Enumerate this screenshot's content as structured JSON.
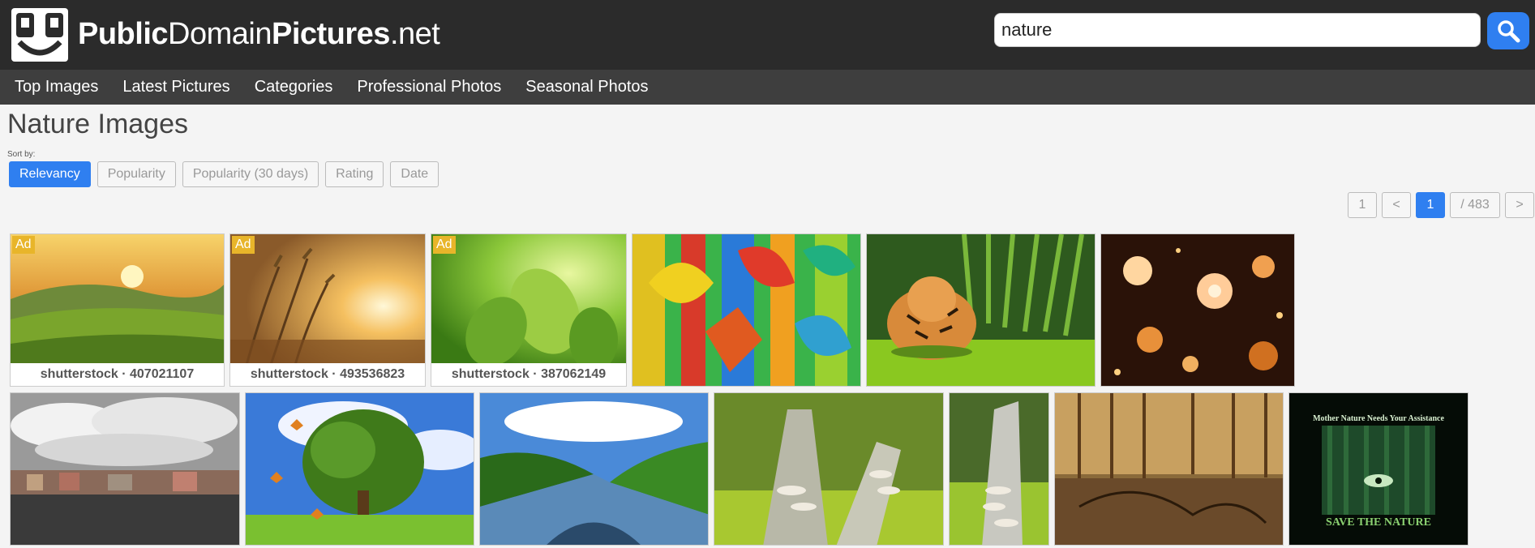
{
  "site": {
    "logo_bold_1": "Public",
    "logo_light": "Domain",
    "logo_bold_2": "Pictures",
    "logo_tld": ".net"
  },
  "search": {
    "value": "nature",
    "icon": "search-icon"
  },
  "nav": {
    "items": [
      {
        "label": "Top Images"
      },
      {
        "label": "Latest Pictures"
      },
      {
        "label": "Categories"
      },
      {
        "label": "Professional Photos"
      },
      {
        "label": "Seasonal Photos"
      }
    ]
  },
  "page": {
    "title": "Nature Images",
    "sort_label": "Sort by:"
  },
  "sort": {
    "options": [
      {
        "label": "Relevancy",
        "active": true
      },
      {
        "label": "Popularity"
      },
      {
        "label": "Popularity (30 days)"
      },
      {
        "label": "Rating"
      },
      {
        "label": "Date"
      }
    ]
  },
  "pagination": {
    "first": "1",
    "prev": "<",
    "current": "1",
    "total": "/ 483",
    "next": ">"
  },
  "ads": [
    {
      "badge": "Ad",
      "label": "shutterstock · 407021107"
    },
    {
      "badge": "Ad",
      "label": "shutterstock · 493536823"
    },
    {
      "badge": "Ad",
      "label": "shutterstock · 387062149"
    }
  ],
  "poster": {
    "top": "Mother Nature Needs Your Assistance",
    "bottom": "SAVE THE NATURE"
  },
  "colors": {
    "accent": "#2f7ff0",
    "header": "#2b2b2b",
    "nav": "#3e3e3e",
    "ad": "#e8b52a"
  }
}
